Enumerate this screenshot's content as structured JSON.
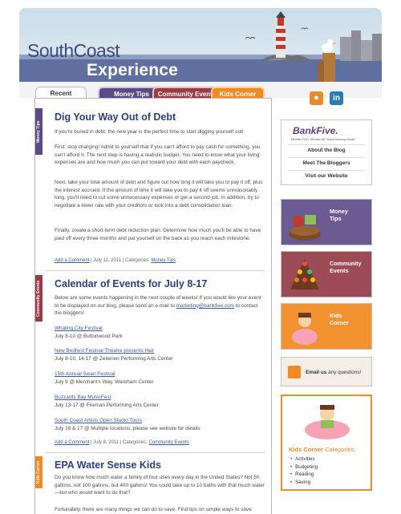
{
  "header": {
    "logo_line1": "SouthCoast",
    "logo_line2": "Experience"
  },
  "tabs": [
    {
      "label": "Recent"
    },
    {
      "label": "Money Tips"
    },
    {
      "label": "Community Events"
    },
    {
      "label": "Kids Corner"
    }
  ],
  "posts": {
    "debt": {
      "category": "Money Tips",
      "title": "Dig Your Way Out of Debt",
      "p1": "If you're buried in debt, the new year is the perfect time to start digging yourself out!",
      "p2": "First: stop charging! Admit to yourself that if you can't afford to pay cash for something, you can't afford it. The next step is having a realistic budget. You need to know what your living expenses are and how much you can put toward your debt with each paycheck.",
      "p3": "Next, take your total amount of debt and figure out how long it will take you to pay it off, plus the interest accrued. If the amount of time it will take you to pay it off seems unreasonably long, you'll need to cut some unnecessary expenses or get a second job. In addition, try to negotiate a lower rate with your creditors or look into a debt consolidation loan.",
      "p4": "Finally, create a short-term debt reduction plan. Determine how much you'll be able to have paid off every three months and pat yourself on the back as you reach each milestone.",
      "comment": "Add a Comment",
      "date": "| July 11, 2011 | Categories:",
      "cat_link": "Money Tips"
    },
    "events": {
      "category": "Community Events",
      "title": "Calendar of Events for July 8-17",
      "intro": "Below are some events happening in the next couple of weeks! If you would like your event to be displayed on our blog, please send an e-mail to",
      "email": "marketing@bankfive.com",
      "intro_end": "to contact the bloggers!",
      "items": [
        {
          "name": "Whaling City Festival",
          "when": "July 8-10 @ Buttonwood Park"
        },
        {
          "name": "New Bedford Festival Theatre presents Hair",
          "when": "July 8-10, 14-17 @ Zeiterion Performing Arts Center"
        },
        {
          "name": "15th Annual Swan Festival",
          "when": "July 9 @ Merchant's Way, Wareham Center"
        },
        {
          "name": "Buzzards Bay MusicFest",
          "when": "July 13-17 @ Fireman Performing Arts Center"
        },
        {
          "name": "South Coast Artists Open Studio Tours",
          "when": "July 16 & 17 @ Multiple locations, please see website for details"
        }
      ],
      "comment": "Add a Comment",
      "date": "| July 8, 2011 | Categories:",
      "cat_link": "Community Events"
    },
    "water": {
      "category": "Kids Corner",
      "title": "EPA Water Sense Kids",
      "p1": "Do you know how much water a family of four uses every day in the United States? Not 50 gallons, not 100 gallons, but 400 gallons! You could take up to 10 baths with that much water—but who would want to do that?",
      "p2": "Fortunately, there are many things we can do to save. Find tips on simple ways to save"
    }
  },
  "sidebar": {
    "bank_logo": "BankFive.",
    "bank_sub": "Member FDIC. Member DIF. Equal Housing Lender.",
    "links": [
      "About the Blog",
      "Meet The Bloggers",
      "Visit our Website"
    ],
    "cats": [
      {
        "line1": "Money",
        "line2": "Tips"
      },
      {
        "line1": "Community",
        "line2": "Events"
      },
      {
        "line1": "Kids",
        "line2": "Corner"
      }
    ],
    "email_bold": "Email us",
    "email_rest": "any questions!",
    "kids_title_bold": "Kids Corner",
    "kids_title_rest": "Categories:",
    "kids_list": [
      "Activities",
      "Budgeting",
      "Reading",
      "Saving"
    ]
  },
  "colors": {
    "money": "#5b4a86",
    "community": "#9b3b46",
    "kids": "#f28a23",
    "title": "#2c3e7c"
  }
}
